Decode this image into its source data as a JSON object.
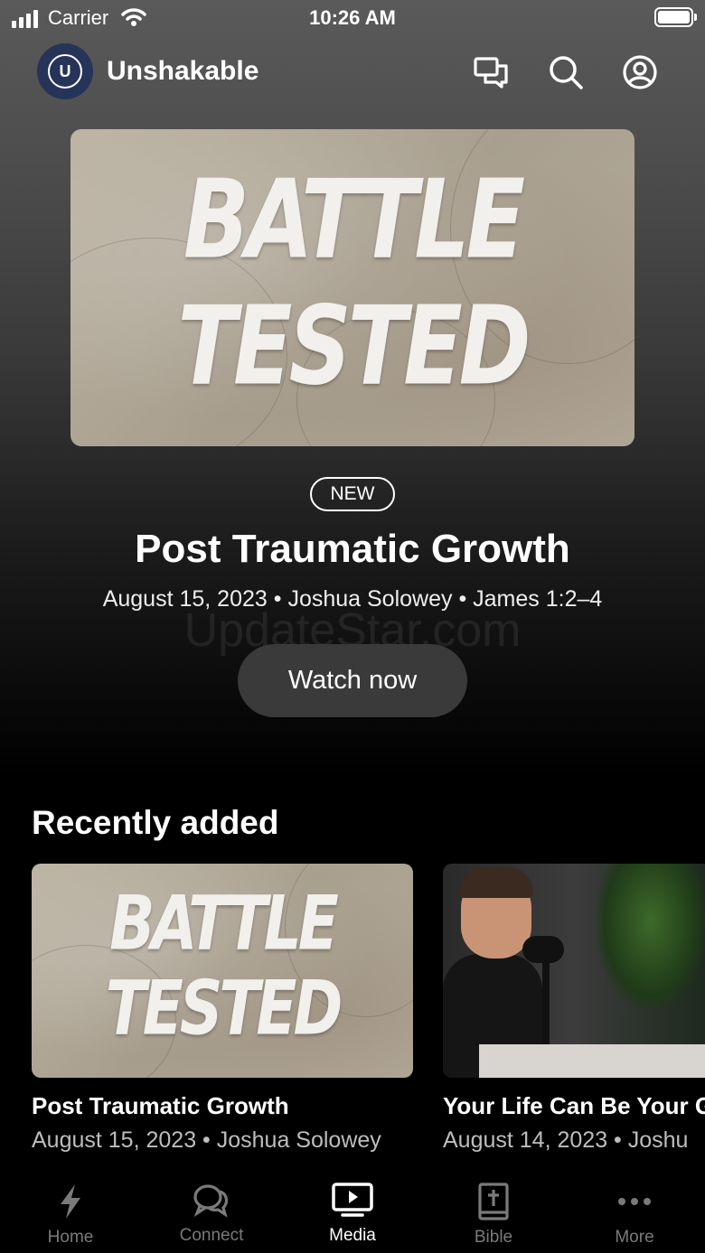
{
  "status_bar": {
    "carrier": "Carrier",
    "time": "10:26 AM"
  },
  "header": {
    "logo_letter": "U",
    "app_name": "Unshakable",
    "icons": [
      "chat-icon",
      "search-icon",
      "account-icon"
    ]
  },
  "hero": {
    "art_line1": "BATTLE",
    "art_line2": "TESTED",
    "badge": "NEW",
    "title": "Post Traumatic Growth",
    "meta": "August 15, 2023 • Joshua Solowey • James 1:2–4",
    "watch_label": "Watch now",
    "watermark": "UpdateStar.com"
  },
  "recently_added": {
    "title": "Recently added",
    "items": [
      {
        "title": "Post Traumatic Growth",
        "meta": "August 15, 2023 • Joshua Solowey",
        "art_line1": "BATTLE",
        "art_line2": "TESTED"
      },
      {
        "title": "Your Life Can Be Your G",
        "meta": "August 14, 2023 • Joshu"
      }
    ]
  },
  "tabs": [
    {
      "label": "Home",
      "icon": "bolt-icon",
      "active": false
    },
    {
      "label": "Connect",
      "icon": "chat-icon",
      "active": false
    },
    {
      "label": "Media",
      "icon": "play-screen-icon",
      "active": true
    },
    {
      "label": "Bible",
      "icon": "bible-icon",
      "active": false
    },
    {
      "label": "More",
      "icon": "more-icon",
      "active": false
    }
  ]
}
